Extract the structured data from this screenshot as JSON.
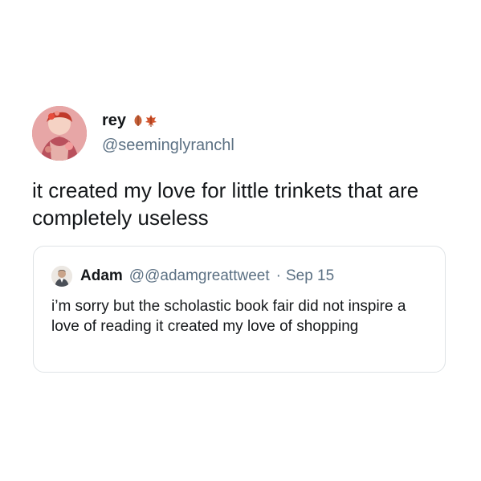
{
  "tweet": {
    "display_name": "rey",
    "handle": "@seeminglyranchl",
    "text": "it created my love for little trinkets that are completely useless",
    "avatar_icon": "profile-photo",
    "name_emojis": [
      "fallen-leaf-icon",
      "maple-leaf-icon"
    ]
  },
  "quoted_tweet": {
    "display_name": "Adam",
    "handle": "@@adamgreattweet",
    "separator": "·",
    "date": "Sep 15",
    "text": "i’m sorry but the scholastic book fair did not inspire a love of reading it created my love of shopping",
    "avatar_icon": "profile-photo"
  },
  "colors": {
    "text_primary": "#14171a",
    "text_secondary": "#5b7083",
    "card_border": "#dfe3e6",
    "background": "#ffffff"
  }
}
